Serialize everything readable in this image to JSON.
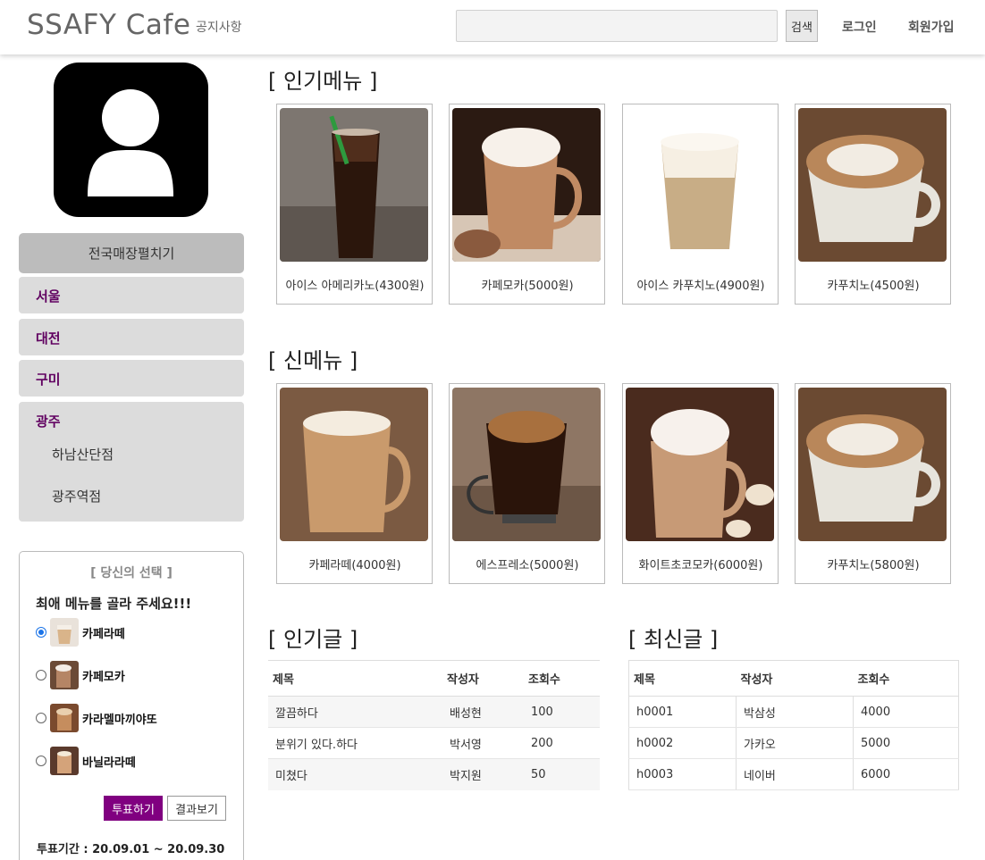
{
  "header": {
    "brand": "SSAFY Cafe",
    "notice": "공지사항",
    "search_placeholder": "",
    "search_button": "검색",
    "login": "로그인",
    "signup": "회원가입"
  },
  "sidebar": {
    "store_toggle": "전국매장펼치기",
    "regions": [
      {
        "label": "서울",
        "branches": []
      },
      {
        "label": "대전",
        "branches": []
      },
      {
        "label": "구미",
        "branches": []
      },
      {
        "label": "광주",
        "branches": [
          "하남산단점",
          "광주역점"
        ]
      }
    ]
  },
  "poll": {
    "title": "[ 당신의 선택 ]",
    "question": "최애 메뉴를 골라 주세요!!!",
    "options": [
      {
        "label": "카페라떼",
        "selected": true
      },
      {
        "label": "카페모카",
        "selected": false
      },
      {
        "label": "카라멜마끼야또",
        "selected": false
      },
      {
        "label": "바닐라라떼",
        "selected": false
      }
    ],
    "vote_button": "투표하기",
    "result_button": "결과보기",
    "period": "투표기간 : 20.09.01 ~ 20.09.30"
  },
  "popular_menu": {
    "title": "[ 인기메뉴 ]",
    "items": [
      {
        "caption": "아이스 아메리카노(4300원)",
        "image": "iced-americano-photo"
      },
      {
        "caption": "카페모카(5000원)",
        "image": "cafe-mocha-photo"
      },
      {
        "caption": "아이스 카푸치노(4900원)",
        "image": "iced-cappuccino-photo"
      },
      {
        "caption": "카푸치노(4500원)",
        "image": "cappuccino-photo"
      }
    ]
  },
  "new_menu": {
    "title": "[ 신메뉴 ]",
    "items": [
      {
        "caption": "카페라떼(4000원)",
        "image": "cafe-latte-photo"
      },
      {
        "caption": "에스프레소(5000원)",
        "image": "espresso-photo"
      },
      {
        "caption": "화이트초코모카(6000원)",
        "image": "white-choco-mocha-photo"
      },
      {
        "caption": "카푸치노(5800원)",
        "image": "cappuccino-photo"
      }
    ]
  },
  "popular_posts": {
    "title": "[ 인기글 ]",
    "columns": [
      "제목",
      "작성자",
      "조회수"
    ],
    "rows": [
      [
        "깔끔하다",
        "배성현",
        "100"
      ],
      [
        "분위기 있다.하다",
        "박서영",
        "200"
      ],
      [
        "미쳤다",
        "박지원",
        "50"
      ]
    ]
  },
  "recent_posts": {
    "title": "[ 최신글 ]",
    "columns": [
      "제목",
      "작성자",
      "조회수"
    ],
    "rows": [
      [
        "h0001",
        "박삼성",
        "4000"
      ],
      [
        "h0002",
        "가카오",
        "5000"
      ],
      [
        "h0003",
        "네이버",
        "6000"
      ]
    ]
  }
}
